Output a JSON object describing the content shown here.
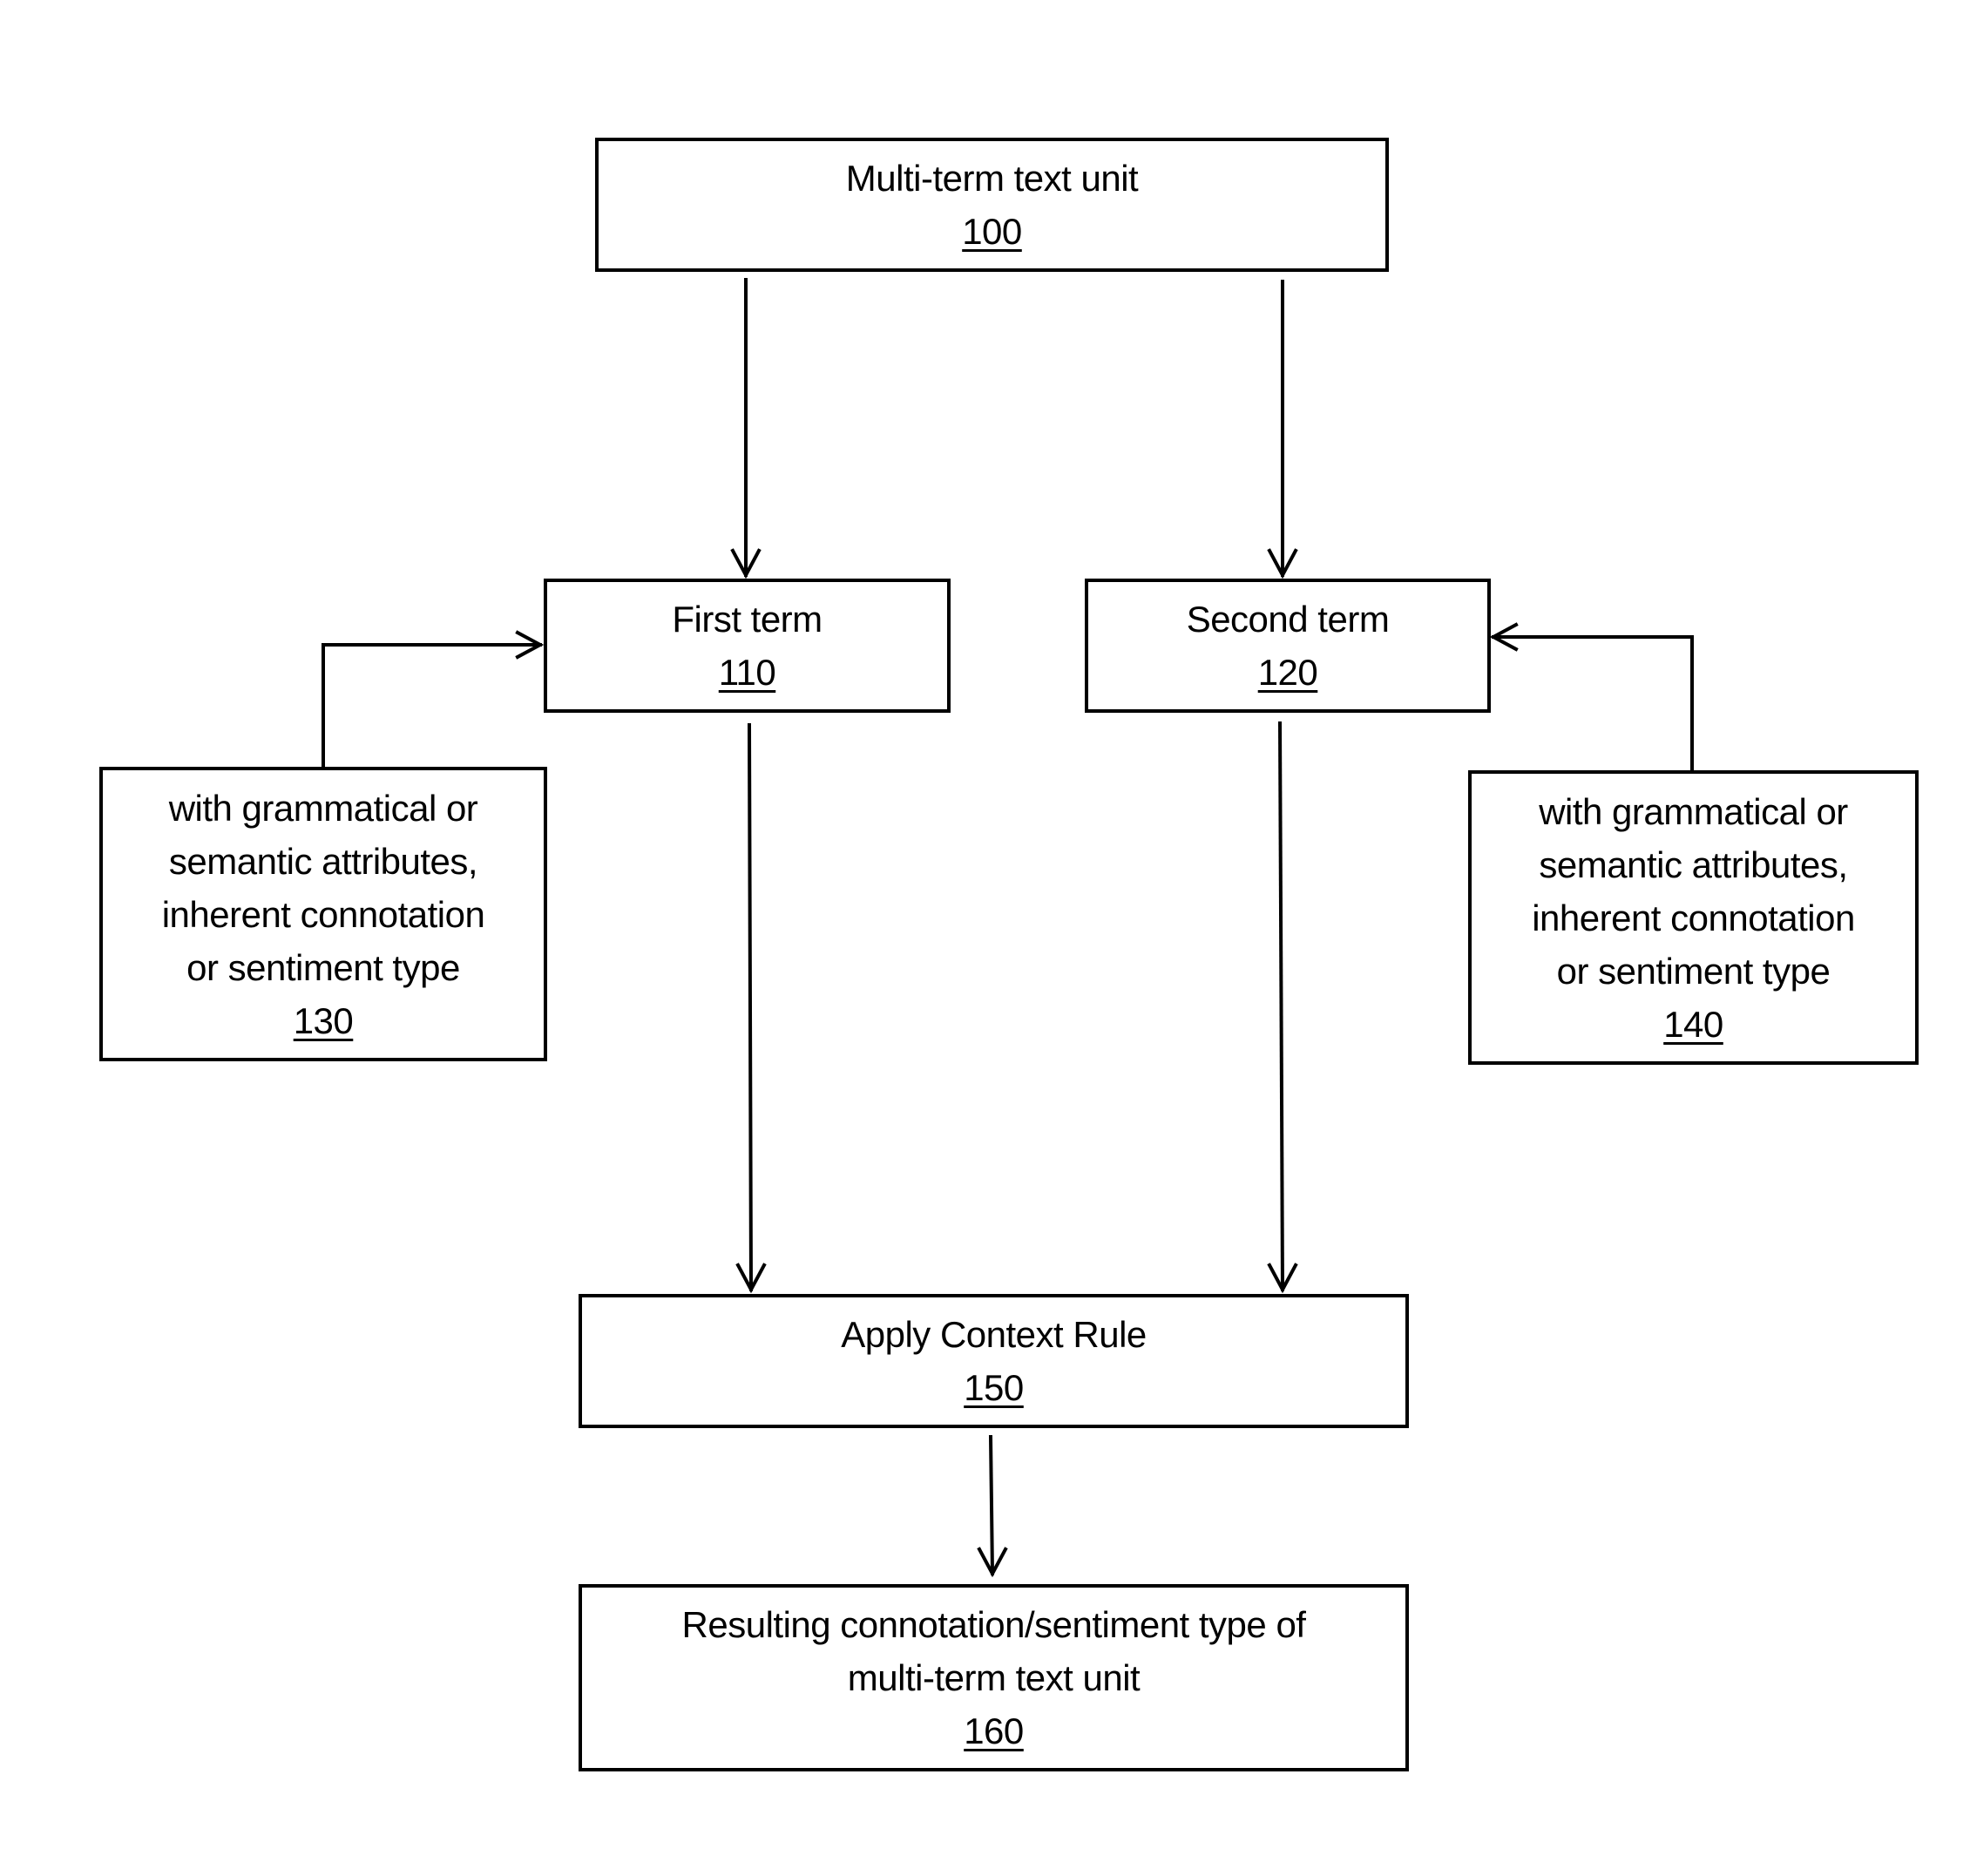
{
  "diagram": {
    "nodes": [
      {
        "id": "n100",
        "lines": [
          "Multi-term text unit"
        ],
        "ref": "100"
      },
      {
        "id": "n110",
        "lines": [
          "First term"
        ],
        "ref": "110"
      },
      {
        "id": "n120",
        "lines": [
          "Second term"
        ],
        "ref": "120"
      },
      {
        "id": "n130",
        "lines": [
          "with grammatical or",
          "semantic attributes,",
          "inherent connotation",
          "or sentiment type"
        ],
        "ref": "130"
      },
      {
        "id": "n140",
        "lines": [
          "with grammatical or",
          "semantic attributes,",
          "inherent connotation",
          "or sentiment type"
        ],
        "ref": "140"
      },
      {
        "id": "n150",
        "lines": [
          "Apply Context Rule"
        ],
        "ref": "150"
      },
      {
        "id": "n160",
        "lines": [
          "Resulting connotation/sentiment type of",
          "multi-term text unit"
        ],
        "ref": "160"
      }
    ],
    "edges": [
      {
        "from": "100",
        "to": "110"
      },
      {
        "from": "100",
        "to": "120"
      },
      {
        "from": "130",
        "to": "110"
      },
      {
        "from": "140",
        "to": "120"
      },
      {
        "from": "110",
        "to": "150"
      },
      {
        "from": "120",
        "to": "150"
      },
      {
        "from": "150",
        "to": "160"
      }
    ]
  }
}
